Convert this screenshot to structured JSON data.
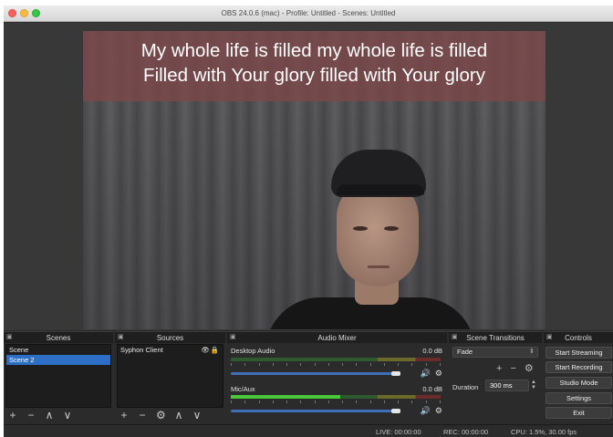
{
  "window": {
    "title": "OBS 24.0.6 (mac) - Profile: Untitled - Scenes: Untitled"
  },
  "preview": {
    "lyrics": [
      "My whole life is filled my whole life is filled",
      "Filled with Your glory filled with Your glory"
    ]
  },
  "docks": {
    "scenes": {
      "title": "Scenes",
      "items": [
        {
          "label": "Scene",
          "selected": false
        },
        {
          "label": "Scene 2",
          "selected": true
        }
      ],
      "toolbar": [
        "+",
        "−",
        "∧",
        "∨"
      ]
    },
    "sources": {
      "title": "Sources",
      "items": [
        {
          "label": "Syphon Client",
          "visible": true,
          "locked": true
        }
      ],
      "toolbar": [
        "+",
        "−",
        "⚙",
        "∧",
        "∨"
      ]
    },
    "audio_mixer": {
      "title": "Audio Mixer",
      "tracks": [
        {
          "name": "Desktop Audio",
          "db": "0.0 dB",
          "level": 0.0
        },
        {
          "name": "Mic/Aux",
          "db": "0.0 dB",
          "level": 0.52
        }
      ]
    },
    "scene_transitions": {
      "title": "Scene Transitions",
      "transition": "Fade",
      "duration_label": "Duration",
      "duration_value": "300 ms"
    },
    "controls": {
      "title": "Controls",
      "buttons": [
        "Start Streaming",
        "Start Recording",
        "Studio Mode",
        "Settings",
        "Exit"
      ]
    }
  },
  "status": {
    "live": "LIVE: 00:00:00",
    "rec": "REC: 00:00:00",
    "cpu": "CPU: 1.5%, 30.00 fps"
  },
  "colors": {
    "selection": "#2d6fc7",
    "meter_green": "#49c83a",
    "lyric_band": "#7d4648"
  }
}
